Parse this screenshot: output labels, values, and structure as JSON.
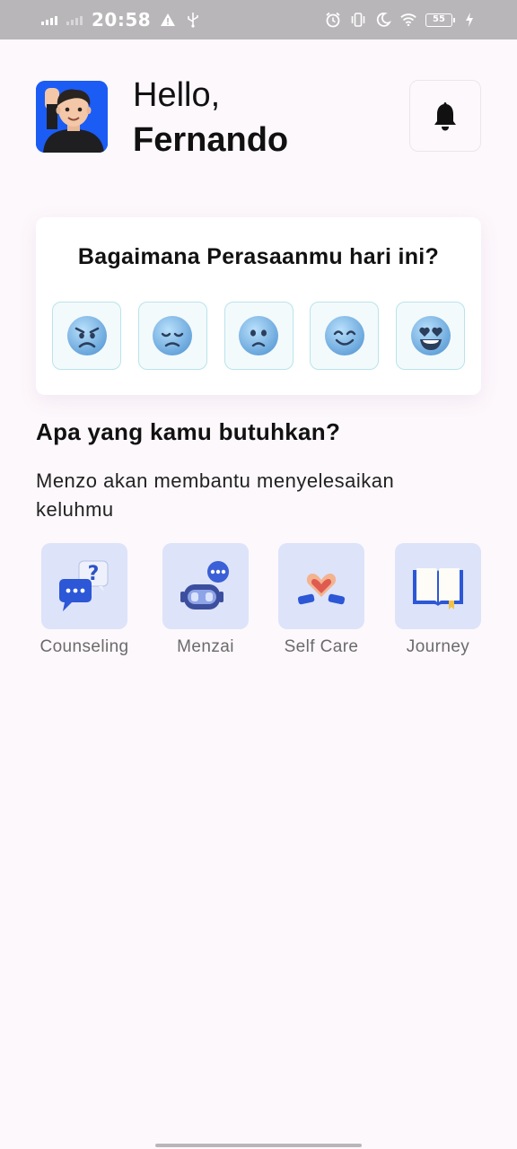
{
  "status_bar": {
    "time": "20:58",
    "battery": "55",
    "icons": [
      "signal-icon",
      "signal-icon",
      "warning-icon",
      "usb-icon",
      "alarm-icon",
      "vibrate-icon",
      "moon-icon",
      "wifi-icon",
      "battery-icon",
      "charging-icon"
    ]
  },
  "header": {
    "hello": "Hello,",
    "name": "Fernando",
    "avatar_icon": "memoji-avatar",
    "bell_icon": "bell-icon"
  },
  "mood": {
    "title": "Bagaimana Perasaanmu hari ini?",
    "options": [
      "angry-face-icon",
      "sad-face-icon",
      "worried-face-icon",
      "smiling-face-icon",
      "heart-eyes-face-icon"
    ]
  },
  "needs": {
    "title": "Apa yang kamu butuhkan?",
    "description": "Menzo akan membantu menyelesaikan keluhmu",
    "services": [
      {
        "label": "Counseling",
        "icon": "chat-question-icon"
      },
      {
        "label": "Menzai",
        "icon": "robot-chat-icon"
      },
      {
        "label": "Self Care",
        "icon": "heart-hands-icon"
      },
      {
        "label": "Journey",
        "icon": "open-book-icon"
      }
    ]
  },
  "colors": {
    "background": "#fdf8fc",
    "avatar_bg": "#1b5cf5",
    "service_tile": "#dde3f9",
    "mood_border": "#b9e4ec",
    "face": "#7ab8e6"
  }
}
